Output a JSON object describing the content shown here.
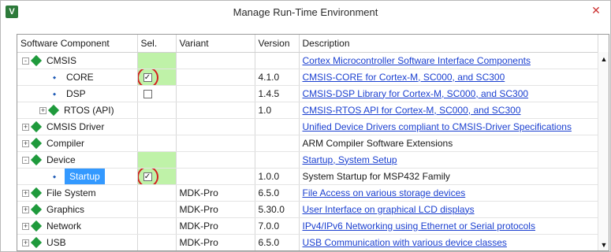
{
  "window": {
    "title": "Manage Run-Time Environment"
  },
  "columns": {
    "component": "Software Component",
    "sel": "Sel.",
    "variant": "Variant",
    "version": "Version",
    "description": "Description"
  },
  "rows": [
    {
      "name": "CMSIS",
      "level": 0,
      "expander": "-",
      "variant": "",
      "version": "",
      "description": "Cortex Microcontroller Software Interface Components",
      "link": true,
      "sel_green": true,
      "checkbox": "none"
    },
    {
      "name": "CORE",
      "level": 1,
      "expander": "",
      "variant": "",
      "version": "4.1.0",
      "description": "CMSIS-CORE for Cortex-M, SC000, and SC300",
      "link": true,
      "sel_green": true,
      "checkbox": "checked",
      "circled": true
    },
    {
      "name": "DSP",
      "level": 1,
      "expander": "",
      "variant": "",
      "version": "1.4.5",
      "description": "CMSIS-DSP Library for Cortex-M, SC000, and SC300",
      "link": true,
      "sel_green": false,
      "checkbox": "unchecked"
    },
    {
      "name": "RTOS (API)",
      "level": 1,
      "expander": "+",
      "variant": "",
      "version": "1.0",
      "description": "CMSIS-RTOS API for Cortex-M, SC000, and SC300",
      "link": true,
      "sel_green": false,
      "checkbox": "none"
    },
    {
      "name": "CMSIS Driver",
      "level": 0,
      "expander": "+",
      "variant": "",
      "version": "",
      "description": "Unified Device Drivers compliant to CMSIS-Driver Specifications",
      "link": true,
      "sel_green": false,
      "checkbox": "none"
    },
    {
      "name": "Compiler",
      "level": 0,
      "expander": "+",
      "variant": "",
      "version": "",
      "description": "ARM Compiler Software Extensions",
      "link": false,
      "sel_green": false,
      "checkbox": "none"
    },
    {
      "name": "Device",
      "level": 0,
      "expander": "-",
      "variant": "",
      "version": "",
      "description": "Startup, System Setup",
      "link": true,
      "sel_green": true,
      "checkbox": "none"
    },
    {
      "name": "Startup",
      "level": 1,
      "expander": "",
      "variant": "",
      "version": "1.0.0",
      "description": "System Startup for MSP432 Family",
      "link": false,
      "sel_green": true,
      "checkbox": "checked",
      "circled": true,
      "selected": true
    },
    {
      "name": "File System",
      "level": 0,
      "expander": "+",
      "variant": "MDK-Pro",
      "version": "6.5.0",
      "description": "File Access on various storage devices",
      "link": true,
      "sel_green": false,
      "checkbox": "none"
    },
    {
      "name": "Graphics",
      "level": 0,
      "expander": "+",
      "variant": "MDK-Pro",
      "version": "5.30.0",
      "description": "User Interface on graphical LCD displays",
      "link": true,
      "sel_green": false,
      "checkbox": "none"
    },
    {
      "name": "Network",
      "level": 0,
      "expander": "+",
      "variant": "MDK-Pro",
      "version": "7.0.0",
      "description": "IPv4/IPv6 Networking using Ethernet or Serial protocols",
      "link": true,
      "sel_green": false,
      "checkbox": "none"
    },
    {
      "name": "USB",
      "level": 0,
      "expander": "+",
      "variant": "MDK-Pro",
      "version": "6.5.0",
      "description": "USB Communication with various device classes",
      "link": true,
      "sel_green": false,
      "checkbox": "none"
    }
  ],
  "colors": {
    "selected_bg": "#3399ff",
    "green_sel": "#bff2a8",
    "link": "#1a3fd0",
    "highlight_ring": "#d32020"
  }
}
